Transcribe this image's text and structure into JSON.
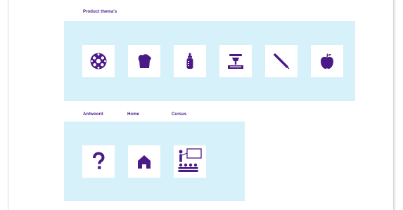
{
  "product_themes": {
    "label": "Product thema's",
    "tiles": [
      {
        "icon": "ball-icon"
      },
      {
        "icon": "bread-icon"
      },
      {
        "icon": "baby-bottle-icon"
      },
      {
        "icon": "kitchen-scale-icon"
      },
      {
        "icon": "thermometer-icon"
      },
      {
        "icon": "apple-icon"
      }
    ]
  },
  "navigation": {
    "labels": {
      "answer": "Antwoord",
      "home": "Home",
      "course": "Cursus"
    },
    "tiles": [
      {
        "icon": "question-mark-icon"
      },
      {
        "icon": "house-icon"
      },
      {
        "icon": "classroom-icon"
      }
    ]
  },
  "colors": {
    "accent": "#4a1a86",
    "panel": "#d7f1fb",
    "tile": "#ffffff"
  }
}
